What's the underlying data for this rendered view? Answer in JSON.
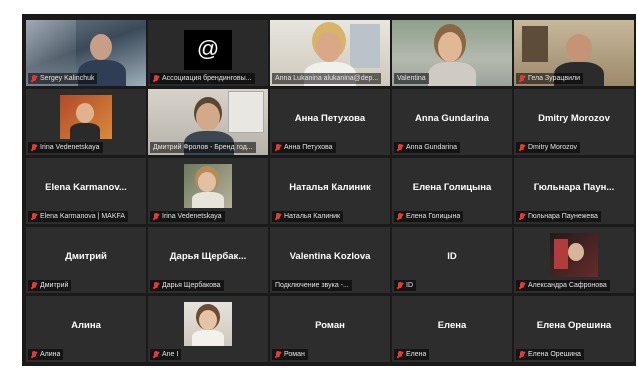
{
  "tiles": [
    {
      "label": "Sergey Kalinchuk",
      "display": "",
      "muted": true
    },
    {
      "label": "Ассоциация брендинговы...",
      "display": "",
      "muted": true,
      "logo": "@"
    },
    {
      "label": "Anna Lukanina alukanina@dep...",
      "display": "",
      "muted": false
    },
    {
      "label": "Valentina",
      "display": "",
      "muted": false
    },
    {
      "label": "Гела Зурацвили",
      "display": "",
      "muted": true
    },
    {
      "label": "Irina Vedenetskaya",
      "display": "",
      "muted": true
    },
    {
      "label": "Дмитрий Фролов - Бренд год...",
      "display": "",
      "muted": false
    },
    {
      "label": "Анна Петухова",
      "display": "Анна Петухова",
      "muted": true
    },
    {
      "label": "Anna Gundarina",
      "display": "Anna Gundarina",
      "muted": true
    },
    {
      "label": "Dmitry Morozov",
      "display": "Dmitry Morozov",
      "muted": true
    },
    {
      "label": "Elena Karmanova | MAKFA",
      "display": "Elena Karmanov...",
      "muted": true
    },
    {
      "label": "Irina Vedenetskaya",
      "display": "",
      "muted": true
    },
    {
      "label": "Наталья Калиник",
      "display": "Наталья Калиник",
      "muted": true
    },
    {
      "label": "Елена Голицына",
      "display": "Елена Голицына",
      "muted": true
    },
    {
      "label": "Гюльнара Паунежева",
      "display": "Гюльнара Паун...",
      "muted": true
    },
    {
      "label": "Дмитрий",
      "display": "Дмитрий",
      "muted": true
    },
    {
      "label": "Дарья Щербакова",
      "display": "Дарья Щербак...",
      "muted": true
    },
    {
      "label": "Подключение звука -...",
      "display": "Valentina Kozlova",
      "muted": false
    },
    {
      "label": "ID",
      "display": "ID",
      "muted": true
    },
    {
      "label": "Александра Сафронова",
      "display": "",
      "muted": true
    },
    {
      "label": "Алина",
      "display": "Алина",
      "muted": true
    },
    {
      "label": "Ane I",
      "display": "",
      "muted": true
    },
    {
      "label": "Роман",
      "display": "Роман",
      "muted": true
    },
    {
      "label": "Елена",
      "display": "Елена",
      "muted": true
    },
    {
      "label": "Елена Орешина",
      "display": "Елена Орешина",
      "muted": true
    }
  ],
  "colors": {
    "muted_icon": "#e53935",
    "active_speaker": "#8bc34a",
    "tile_bg": "#2d2d2d"
  }
}
